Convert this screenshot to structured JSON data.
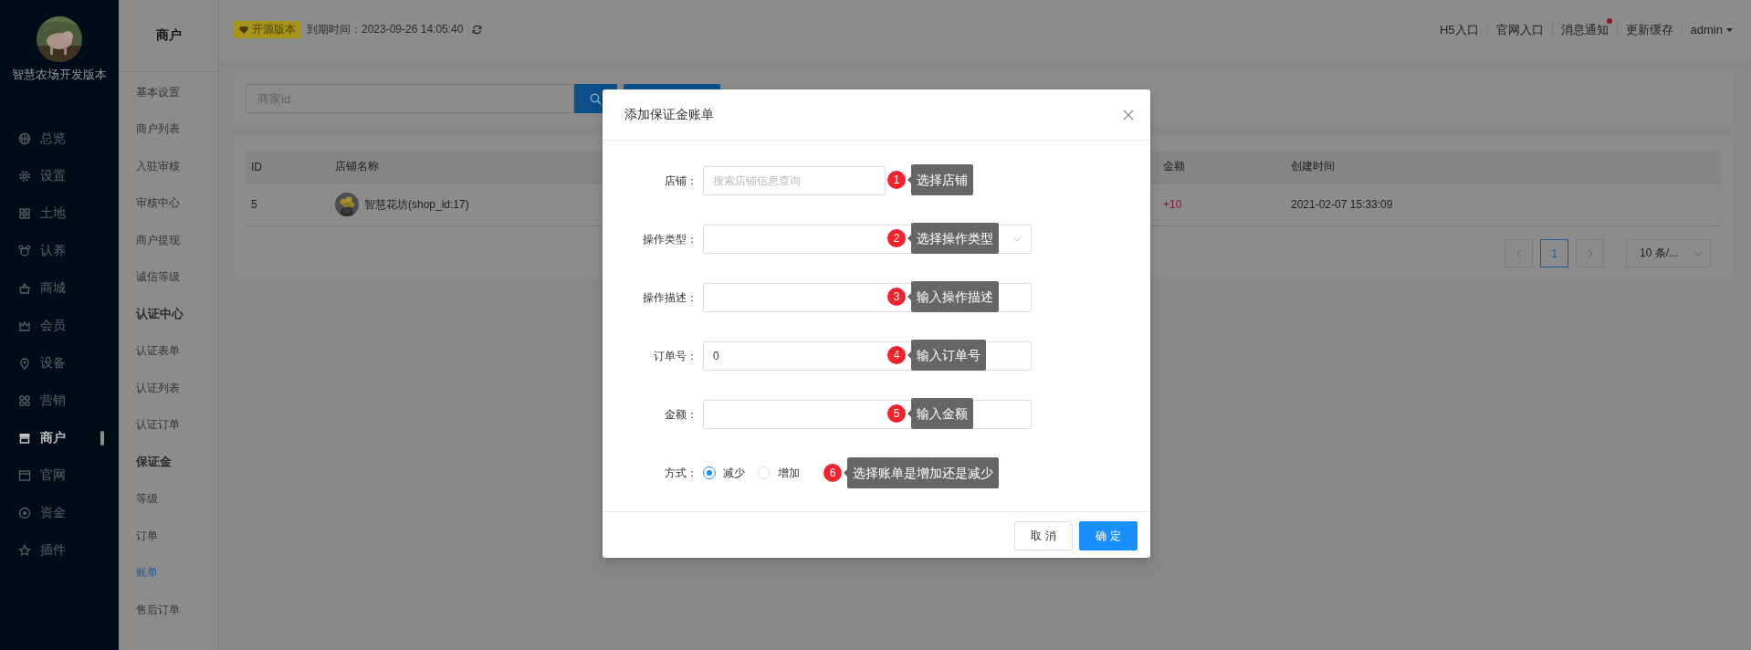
{
  "brand": {
    "name": "智慧农场开发版本"
  },
  "nav": [
    {
      "label": "总览",
      "selected": false
    },
    {
      "label": "设置",
      "selected": false
    },
    {
      "label": "土地",
      "selected": false
    },
    {
      "label": "认养",
      "selected": false
    },
    {
      "label": "商城",
      "selected": false
    },
    {
      "label": "会员",
      "selected": false
    },
    {
      "label": "设备",
      "selected": false
    },
    {
      "label": "营销",
      "selected": false
    },
    {
      "label": "商户",
      "selected": true
    },
    {
      "label": "官网",
      "selected": false
    },
    {
      "label": "资金",
      "selected": false
    },
    {
      "label": "插件",
      "selected": false
    }
  ],
  "subnav": {
    "title": "商户",
    "items": [
      {
        "label": "基本设置",
        "kind": "link",
        "selected": false
      },
      {
        "label": "商户列表",
        "kind": "link",
        "selected": false
      },
      {
        "label": "入驻审核",
        "kind": "link",
        "selected": false
      },
      {
        "label": "审核中心",
        "kind": "link",
        "selected": false
      },
      {
        "label": "商户提现",
        "kind": "link",
        "selected": false
      },
      {
        "label": "诚信等级",
        "kind": "link",
        "selected": false
      },
      {
        "label": "认证中心",
        "kind": "heading",
        "selected": false
      },
      {
        "label": "认证表单",
        "kind": "link",
        "selected": false
      },
      {
        "label": "认证列表",
        "kind": "link",
        "selected": false
      },
      {
        "label": "认证订单",
        "kind": "link",
        "selected": false
      },
      {
        "label": "保证金",
        "kind": "heading",
        "selected": false
      },
      {
        "label": "等级",
        "kind": "link",
        "selected": false
      },
      {
        "label": "订单",
        "kind": "link",
        "selected": false
      },
      {
        "label": "账单",
        "kind": "link",
        "selected": true
      },
      {
        "label": "售后订单",
        "kind": "link",
        "selected": false
      }
    ]
  },
  "topbar": {
    "badge": "开源版本",
    "expiry": "到期时间：2023-09-26 14:05:40",
    "links": [
      {
        "label": "H5入口",
        "unread": false
      },
      {
        "label": "官网入口",
        "unread": false
      },
      {
        "label": "消息通知",
        "unread": true
      },
      {
        "label": "更新缓存",
        "unread": false
      }
    ],
    "user": "admin"
  },
  "search": {
    "placeholder": "商家id"
  },
  "table": {
    "columns": [
      "ID",
      "店铺名称",
      "金额",
      "创建时间"
    ],
    "rows": [
      {
        "id": "5",
        "shop": "智慧花坊(shop_id:17)",
        "amount": "+10",
        "created": "2021-02-07 15:33:09"
      }
    ]
  },
  "pagination": {
    "pages": [
      {
        "label": "1",
        "selected": true
      }
    ],
    "page_size": "10 条/..."
  },
  "modal": {
    "title": "添加保证金账单",
    "fields": [
      {
        "label": "店铺：",
        "kind": "input",
        "placeholder": "搜索店铺信息查询",
        "annotation": {
          "number": "1",
          "text": "选择店铺"
        }
      },
      {
        "label": "操作类型：",
        "kind": "select",
        "annotation": {
          "number": "2",
          "text": "选择操作类型"
        }
      },
      {
        "label": "操作描述：",
        "kind": "input",
        "annotation": {
          "number": "3",
          "text": "输入操作描述"
        }
      },
      {
        "label": "订单号：",
        "kind": "input",
        "value": "0",
        "annotation": {
          "number": "4",
          "text": "输入订单号"
        }
      },
      {
        "label": "金额：",
        "kind": "input",
        "annotation": {
          "number": "5",
          "text": "输入金额"
        }
      },
      {
        "label": "方式：",
        "kind": "radio",
        "options": [
          {
            "label": "减少",
            "selected": true
          },
          {
            "label": "增加",
            "selected": false
          }
        ],
        "annotation": {
          "number": "6",
          "text": "选择账单是增加还是减少"
        }
      }
    ],
    "buttons": [
      {
        "label": "取 消",
        "kind": "default"
      },
      {
        "label": "确 定",
        "kind": "primary"
      }
    ]
  }
}
